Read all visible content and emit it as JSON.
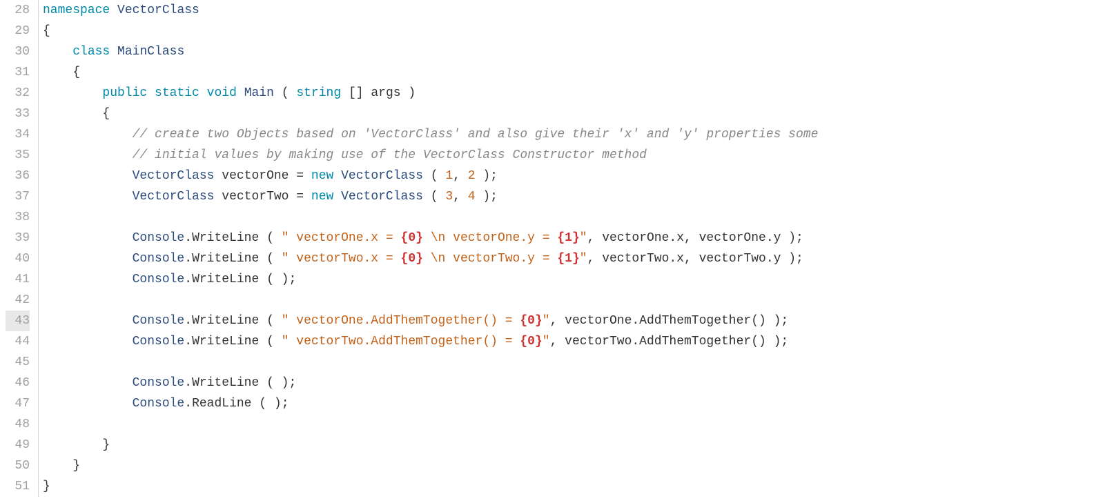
{
  "lines": [
    {
      "num": 28,
      "tokens": [
        {
          "cls": "kw",
          "t": "namespace"
        },
        {
          "cls": "punct",
          "t": " "
        },
        {
          "cls": "type",
          "t": "VectorClass"
        }
      ]
    },
    {
      "num": 29,
      "tokens": [
        {
          "cls": "punct",
          "t": "{"
        }
      ]
    },
    {
      "num": 30,
      "tokens": [
        {
          "cls": "punct",
          "t": "    "
        },
        {
          "cls": "kw",
          "t": "class"
        },
        {
          "cls": "punct",
          "t": " "
        },
        {
          "cls": "type",
          "t": "MainClass"
        }
      ]
    },
    {
      "num": 31,
      "tokens": [
        {
          "cls": "punct",
          "t": "    {"
        }
      ]
    },
    {
      "num": 32,
      "tokens": [
        {
          "cls": "punct",
          "t": "        "
        },
        {
          "cls": "kw",
          "t": "public"
        },
        {
          "cls": "punct",
          "t": " "
        },
        {
          "cls": "kw",
          "t": "static"
        },
        {
          "cls": "punct",
          "t": " "
        },
        {
          "cls": "kw",
          "t": "void"
        },
        {
          "cls": "punct",
          "t": " "
        },
        {
          "cls": "type",
          "t": "Main"
        },
        {
          "cls": "punct",
          "t": " ( "
        },
        {
          "cls": "kw",
          "t": "string"
        },
        {
          "cls": "punct",
          "t": " [] "
        },
        {
          "cls": "args",
          "t": "args"
        },
        {
          "cls": "punct",
          "t": " )"
        }
      ]
    },
    {
      "num": 33,
      "tokens": [
        {
          "cls": "punct",
          "t": "        {"
        }
      ]
    },
    {
      "num": 34,
      "tokens": [
        {
          "cls": "punct",
          "t": "            "
        },
        {
          "cls": "comment",
          "t": "// create two Objects based on 'VectorClass' and also give their 'x' and 'y' properties some"
        }
      ]
    },
    {
      "num": 35,
      "tokens": [
        {
          "cls": "punct",
          "t": "            "
        },
        {
          "cls": "comment",
          "t": "// initial values by making use of the VectorClass Constructor method"
        }
      ]
    },
    {
      "num": 36,
      "tokens": [
        {
          "cls": "punct",
          "t": "            "
        },
        {
          "cls": "type",
          "t": "VectorClass"
        },
        {
          "cls": "punct",
          "t": " "
        },
        {
          "cls": "ident",
          "t": "vectorOne"
        },
        {
          "cls": "punct",
          "t": " = "
        },
        {
          "cls": "kw",
          "t": "new"
        },
        {
          "cls": "punct",
          "t": " "
        },
        {
          "cls": "type",
          "t": "VectorClass"
        },
        {
          "cls": "punct",
          "t": " ( "
        },
        {
          "cls": "num",
          "t": "1"
        },
        {
          "cls": "punct",
          "t": ", "
        },
        {
          "cls": "num",
          "t": "2"
        },
        {
          "cls": "punct",
          "t": " );"
        }
      ]
    },
    {
      "num": 37,
      "tokens": [
        {
          "cls": "punct",
          "t": "            "
        },
        {
          "cls": "type",
          "t": "VectorClass"
        },
        {
          "cls": "punct",
          "t": " "
        },
        {
          "cls": "ident",
          "t": "vectorTwo"
        },
        {
          "cls": "punct",
          "t": " = "
        },
        {
          "cls": "kw",
          "t": "new"
        },
        {
          "cls": "punct",
          "t": " "
        },
        {
          "cls": "type",
          "t": "VectorClass"
        },
        {
          "cls": "punct",
          "t": " ( "
        },
        {
          "cls": "num",
          "t": "3"
        },
        {
          "cls": "punct",
          "t": ", "
        },
        {
          "cls": "num",
          "t": "4"
        },
        {
          "cls": "punct",
          "t": " );"
        }
      ]
    },
    {
      "num": 38,
      "tokens": []
    },
    {
      "num": 39,
      "tokens": [
        {
          "cls": "punct",
          "t": "            "
        },
        {
          "cls": "type",
          "t": "Console"
        },
        {
          "cls": "punct",
          "t": "."
        },
        {
          "cls": "method",
          "t": "WriteLine"
        },
        {
          "cls": "punct",
          "t": " ( "
        },
        {
          "cls": "str",
          "t": "\" vectorOne.x = "
        },
        {
          "cls": "fmt",
          "t": "{0}"
        },
        {
          "cls": "str",
          "t": " "
        },
        {
          "cls": "esc",
          "t": "\\n"
        },
        {
          "cls": "str",
          "t": " vectorOne.y = "
        },
        {
          "cls": "fmt",
          "t": "{1}"
        },
        {
          "cls": "str",
          "t": "\""
        },
        {
          "cls": "punct",
          "t": ", vectorOne.x, vectorOne.y );"
        }
      ]
    },
    {
      "num": 40,
      "tokens": [
        {
          "cls": "punct",
          "t": "            "
        },
        {
          "cls": "type",
          "t": "Console"
        },
        {
          "cls": "punct",
          "t": "."
        },
        {
          "cls": "method",
          "t": "WriteLine"
        },
        {
          "cls": "punct",
          "t": " ( "
        },
        {
          "cls": "str",
          "t": "\" vectorTwo.x = "
        },
        {
          "cls": "fmt",
          "t": "{0}"
        },
        {
          "cls": "str",
          "t": " "
        },
        {
          "cls": "esc",
          "t": "\\n"
        },
        {
          "cls": "str",
          "t": " vectorTwo.y = "
        },
        {
          "cls": "fmt",
          "t": "{1}"
        },
        {
          "cls": "str",
          "t": "\""
        },
        {
          "cls": "punct",
          "t": ", vectorTwo.x, vectorTwo.y );"
        }
      ]
    },
    {
      "num": 41,
      "tokens": [
        {
          "cls": "punct",
          "t": "            "
        },
        {
          "cls": "type",
          "t": "Console"
        },
        {
          "cls": "punct",
          "t": "."
        },
        {
          "cls": "method",
          "t": "WriteLine"
        },
        {
          "cls": "punct",
          "t": " ( );"
        }
      ]
    },
    {
      "num": 42,
      "tokens": []
    },
    {
      "num": 43,
      "current": true,
      "tokens": [
        {
          "cls": "punct",
          "t": "            "
        },
        {
          "cls": "type",
          "t": "Console"
        },
        {
          "cls": "punct",
          "t": "."
        },
        {
          "cls": "method",
          "t": "WriteLine"
        },
        {
          "cls": "punct",
          "t": " ( "
        },
        {
          "cls": "str",
          "t": "\" vectorOne.AddThemTogether() = "
        },
        {
          "cls": "fmt",
          "t": "{0}"
        },
        {
          "cls": "str",
          "t": "\""
        },
        {
          "cls": "punct",
          "t": ", vectorOne.AddThemTogether() );"
        }
      ]
    },
    {
      "num": 44,
      "tokens": [
        {
          "cls": "punct",
          "t": "            "
        },
        {
          "cls": "type",
          "t": "Console"
        },
        {
          "cls": "punct",
          "t": "."
        },
        {
          "cls": "method",
          "t": "WriteLine"
        },
        {
          "cls": "punct",
          "t": " ( "
        },
        {
          "cls": "str",
          "t": "\" vectorTwo.AddThemTogether() = "
        },
        {
          "cls": "fmt",
          "t": "{0}"
        },
        {
          "cls": "str",
          "t": "\""
        },
        {
          "cls": "punct",
          "t": ", vectorTwo.AddThemTogether() );"
        }
      ]
    },
    {
      "num": 45,
      "tokens": []
    },
    {
      "num": 46,
      "tokens": [
        {
          "cls": "punct",
          "t": "            "
        },
        {
          "cls": "type",
          "t": "Console"
        },
        {
          "cls": "punct",
          "t": "."
        },
        {
          "cls": "method",
          "t": "WriteLine"
        },
        {
          "cls": "punct",
          "t": " ( );"
        }
      ]
    },
    {
      "num": 47,
      "tokens": [
        {
          "cls": "punct",
          "t": "            "
        },
        {
          "cls": "type",
          "t": "Console"
        },
        {
          "cls": "punct",
          "t": "."
        },
        {
          "cls": "method",
          "t": "ReadLine"
        },
        {
          "cls": "punct",
          "t": " ( );"
        }
      ]
    },
    {
      "num": 48,
      "tokens": []
    },
    {
      "num": 49,
      "tokens": [
        {
          "cls": "punct",
          "t": "        }"
        }
      ]
    },
    {
      "num": 50,
      "tokens": [
        {
          "cls": "punct",
          "t": "    }"
        }
      ]
    },
    {
      "num": 51,
      "tokens": [
        {
          "cls": "punct",
          "t": "}"
        }
      ]
    }
  ]
}
